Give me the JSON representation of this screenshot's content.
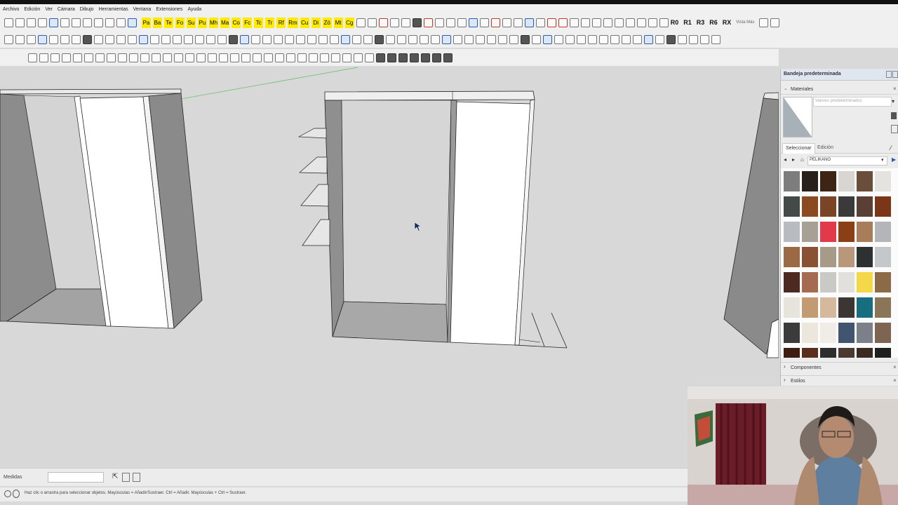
{
  "menu": [
    "Archivo",
    "Edición",
    "Ver",
    "Cámara",
    "Dibujo",
    "Herramientas",
    "Ventana",
    "Extensiones",
    "Ayuda"
  ],
  "toolbar1": {
    "yellow_tools": [
      "Pa",
      "Ba",
      "Te",
      "Fo",
      "Su",
      "Pu",
      "Mh",
      "Ma",
      "Co",
      "Fc",
      "Tc",
      "Tr",
      "Rf",
      "Rm",
      "Cu",
      "Di",
      "Zö",
      "Mt",
      "Cg"
    ],
    "r_commands": [
      "R0",
      "R1",
      "R3",
      "R6",
      "RX"
    ],
    "vista_label": "Vista Más"
  },
  "tray": {
    "title": "Bandeja predeterminada",
    "materials_label": "Materiales",
    "default_values_placeholder": "Valores predeterminados",
    "tab_select": "Seleccionar",
    "tab_edit": "Edición",
    "library": "PELIKANO",
    "components_label": "Componentes",
    "styles_label": "Estilos",
    "swatch_colors": [
      "#7d7d7d",
      "#2a201b",
      "#3d2415",
      "#d8d5d2",
      "#6b4e3a",
      "#e5e3e0",
      "#434a47",
      "#8b4a1f",
      "#7a4527",
      "#3a3a3a",
      "#5a3f34",
      "#7b3519",
      "#b8bbbf",
      "#a7a095",
      "#e23a4a",
      "#8a3f14",
      "#a77d5a",
      "#b3b5b9",
      "#9b6a45",
      "#8a5233",
      "#a79a89",
      "#b8977a",
      "#2e3132",
      "#c5c8cb",
      "#4c2a22",
      "#a56a4f",
      "#c9c9c6",
      "#e2e0dc",
      "#f5d84a",
      "#8c6a45",
      "#e7e4db",
      "#c29b72",
      "#d5b99d",
      "#3b3534",
      "#176e80",
      "#8b7558",
      "#3b3b3b",
      "#ece7dd",
      "#f0ede8",
      "#415570",
      "#7c8088",
      "#7e6551",
      "#3e1e12",
      "#5a2e1a",
      "#2e2e2e",
      "#4a3a30",
      "#3a2b22",
      "#1f1f1f"
    ]
  },
  "status": {
    "measure_label": "Medidas",
    "measure_value": "",
    "hint": "Haz clic o arrastra para seleccionar objetos. Mayúsculas = Añadir/Sustraer. Ctrl = Añadir. Mayúsculas + Ctrl = Sustraer."
  }
}
